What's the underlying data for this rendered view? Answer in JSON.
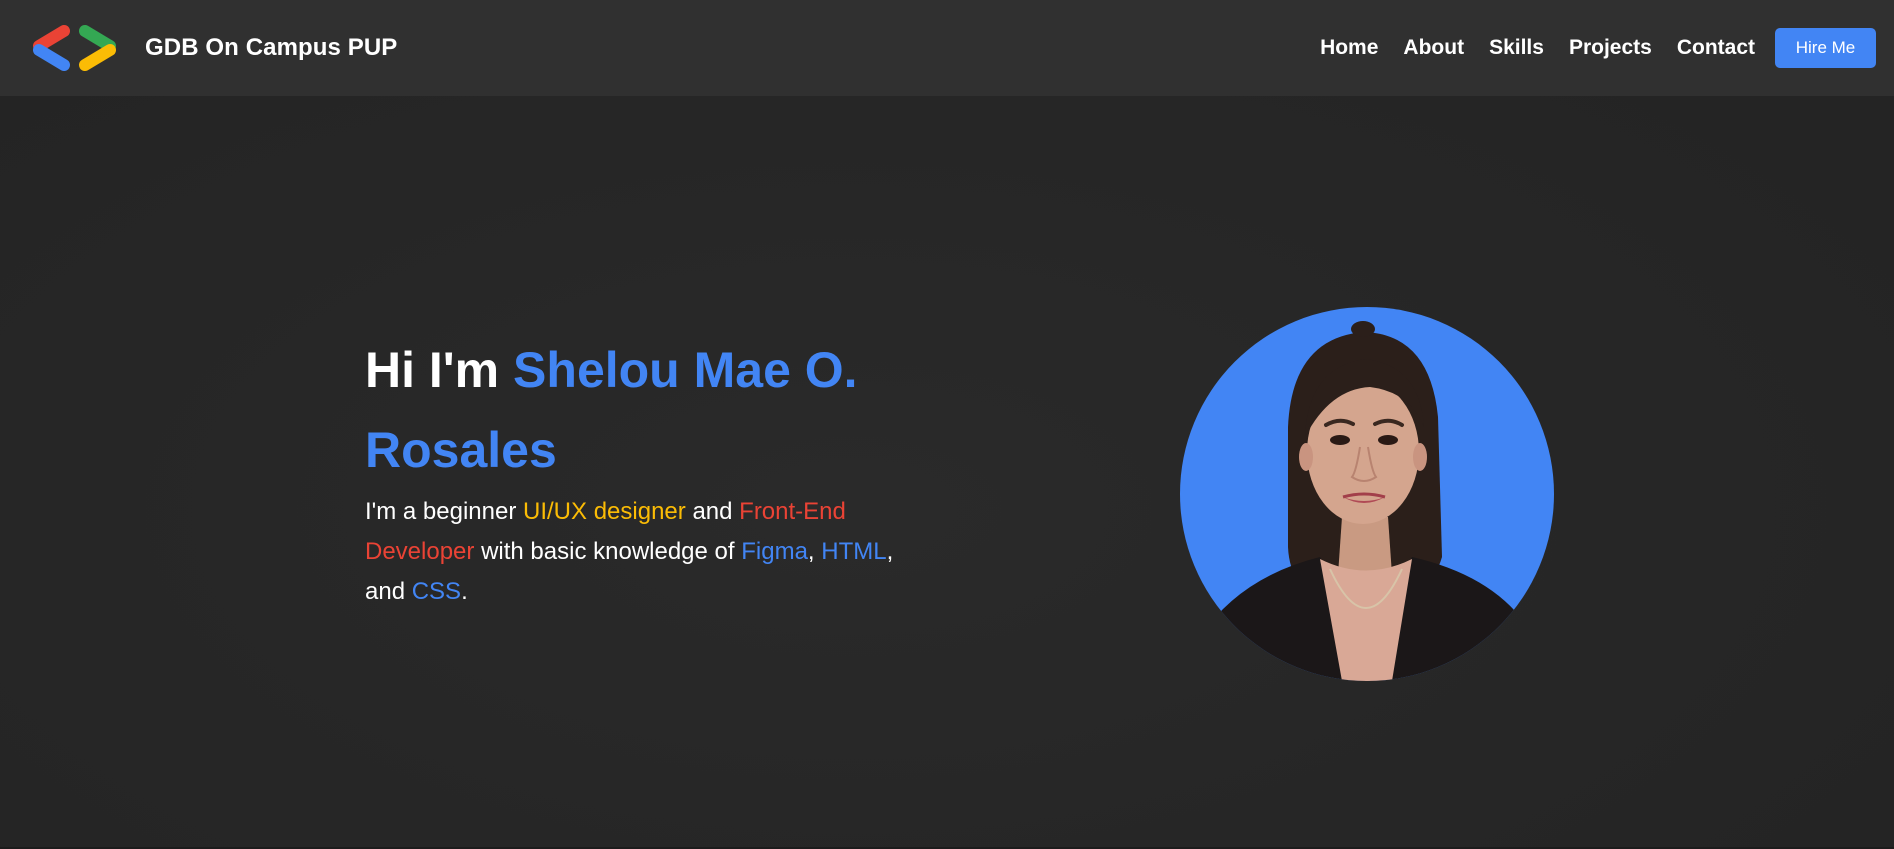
{
  "header": {
    "brand_name": "GDB On Campus PUP",
    "nav": [
      "Home",
      "About",
      "Skills",
      "Projects",
      "Contact"
    ],
    "cta_label": "Hire Me"
  },
  "hero": {
    "greeting": "Hi I'm",
    "name": "Shelou Mae O. Rosales",
    "desc": {
      "t1": "I'm a beginner",
      "role1": "UI/UX designer",
      "t2": "and",
      "role2": "Front-End Developer",
      "t3": "with basic knowledge of",
      "skill1": "Figma",
      "sep1": ",",
      "skill2": "HTML",
      "sep2": ",",
      "t4": "and",
      "skill3": "CSS",
      "end": "."
    }
  },
  "colors": {
    "blue": "#4285f4",
    "red": "#ea4335",
    "yellow": "#fbbc05",
    "green": "#34a853",
    "header_bg": "#303030",
    "page_bg": "#262626"
  },
  "icons": {
    "logo": "gdg-brackets-logo",
    "portrait": "profile-photo"
  }
}
